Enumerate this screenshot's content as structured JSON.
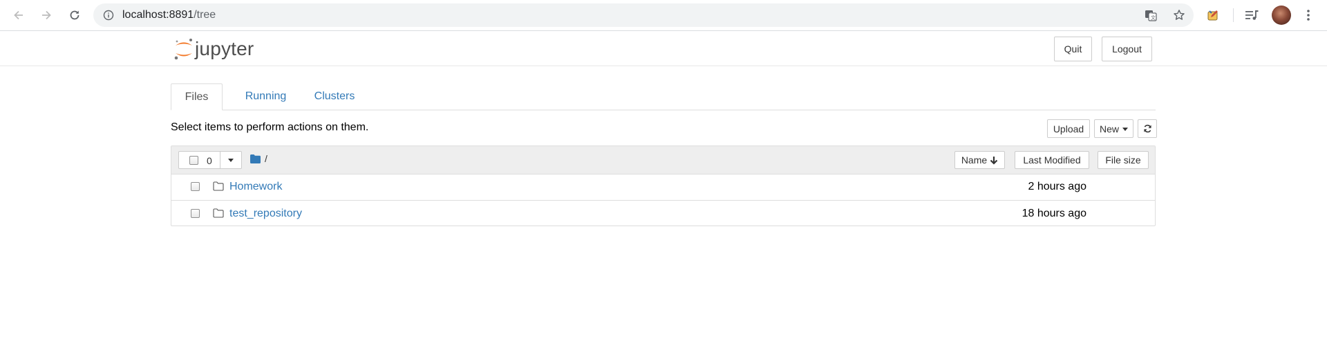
{
  "browser": {
    "url_host": "localhost:8891",
    "url_path": "/tree"
  },
  "header": {
    "logo_text": "jupyter",
    "quit_label": "Quit",
    "logout_label": "Logout"
  },
  "tabs": [
    {
      "label": "Files",
      "active": true
    },
    {
      "label": "Running",
      "active": false
    },
    {
      "label": "Clusters",
      "active": false
    }
  ],
  "toolbar": {
    "hint": "Select items to perform actions on them.",
    "upload_label": "Upload",
    "new_label": "New"
  },
  "list_header": {
    "selected_count": "0",
    "breadcrumb_path": "/",
    "sort_name_label": "Name",
    "sort_modified_label": "Last Modified",
    "sort_size_label": "File size"
  },
  "items": [
    {
      "name": "Homework",
      "type": "folder",
      "modified": "2 hours ago"
    },
    {
      "name": "test_repository",
      "type": "folder",
      "modified": "18 hours ago"
    }
  ],
  "colors": {
    "link": "#337ab7",
    "jupyter_orange": "#f37726"
  }
}
